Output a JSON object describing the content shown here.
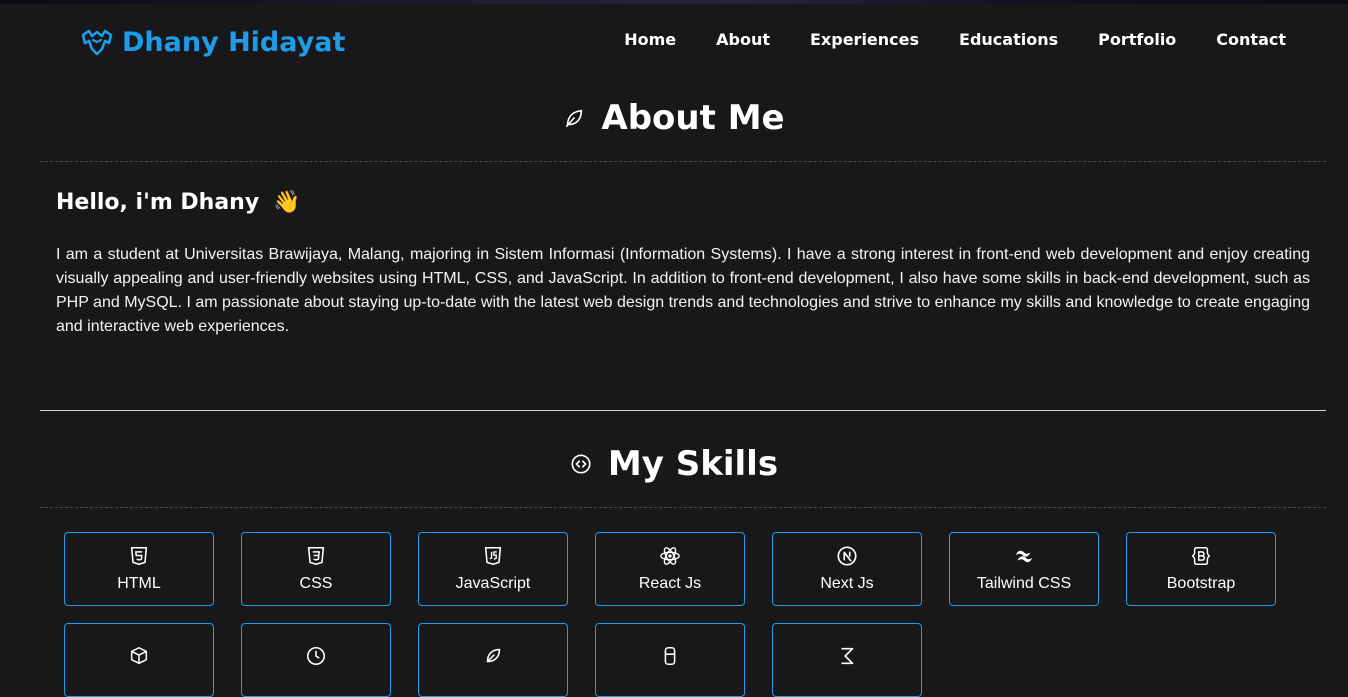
{
  "brand": {
    "name": "Dhany Hidayat",
    "icon": "bat-logo-icon",
    "color": "#1e9ce8"
  },
  "nav": {
    "items": [
      {
        "label": "Home"
      },
      {
        "label": "About"
      },
      {
        "label": "Experiences"
      },
      {
        "label": "Educations"
      },
      {
        "label": "Portfolio"
      },
      {
        "label": "Contact"
      }
    ]
  },
  "about": {
    "title": "About Me",
    "icon": "leaf-icon",
    "greeting": "Hello, i'm Dhany",
    "greeting_emoji": "👋",
    "paragraph": "I am a student at Universitas Brawijaya, Malang, majoring in Sistem Informasi (Information Systems). I have a strong interest in front-end web development and enjoy creating visually appealing and user-friendly websites using HTML, CSS, and JavaScript. In addition to front-end development, I also have some skills in back-end development, such as PHP and MySQL. I am passionate about staying up-to-date with the latest web design trends and technologies and strive to enhance my skills and knowledge to create engaging and interactive web experiences."
  },
  "skills": {
    "title": "My Skills",
    "icon": "code-circle-icon",
    "items": [
      {
        "label": "HTML",
        "icon": "html5-icon"
      },
      {
        "label": "CSS",
        "icon": "css3-icon"
      },
      {
        "label": "JavaScript",
        "icon": "javascript-icon"
      },
      {
        "label": "React Js",
        "icon": "react-icon"
      },
      {
        "label": "Next Js",
        "icon": "nextjs-icon"
      },
      {
        "label": "Tailwind CSS",
        "icon": "tailwind-icon"
      },
      {
        "label": "Bootstrap",
        "icon": "bootstrap-icon"
      },
      {
        "label": "",
        "icon": "skill-icon"
      },
      {
        "label": "",
        "icon": "skill-icon"
      },
      {
        "label": "",
        "icon": "skill-icon"
      },
      {
        "label": "",
        "icon": "skill-icon"
      },
      {
        "label": "",
        "icon": "skill-icon"
      }
    ]
  },
  "colors": {
    "background": "#18181b",
    "accent": "#1e9ce8",
    "text": "#ffffff"
  }
}
